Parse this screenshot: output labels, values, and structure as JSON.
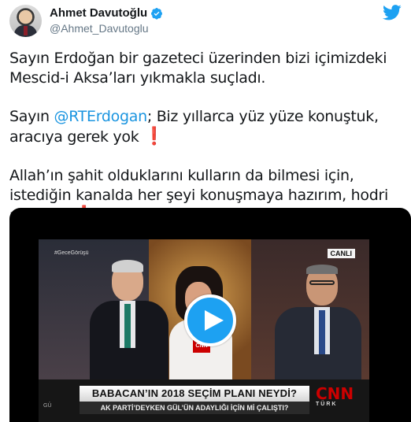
{
  "tweet": {
    "author_name": "Ahmet Davutoğlu",
    "handle": "@Ahmet_Davutoglu",
    "paragraph1": "Sayın Erdoğan bir gazeteci üzerinden bizi içimizdeki Mescid-i Aksa’ları yıkmakla suçladı.",
    "paragraph2_prefix": "Sayın ",
    "mention": "@RTErdogan",
    "paragraph2_suffix": "; Biz yıllarca yüz yüze konuştuk, aracıya gerek yok ",
    "paragraph3": "Allah’ın şahit olduklarını kulların da bilmesi için, istediğin kanalda her şeyi konuşmaya hazırım, hodri meydan ",
    "exclamation": "❗"
  },
  "video": {
    "hashtag": "#GeceGörüşü",
    "live_badge": "CANLI",
    "mic_logo": "CNN",
    "headline": "BABACAN’IN 2018 SEÇİM PLANI NEYDİ?",
    "subheadline": "AK PARTİ’DEYKEN GÜL’ÜN ADAYLIĞI İÇİN Mİ ÇALIŞTI?",
    "side_text": "GÜ",
    "channel_name": "CNN",
    "channel_sub": "TÜRK"
  },
  "colors": {
    "twitter_blue": "#1da1f2",
    "mention": "#1b95e0",
    "exclamation": "#e0102f"
  },
  "icons": {
    "verified": "verified-badge-icon",
    "brand": "twitter-bird-icon",
    "play": "play-icon"
  }
}
